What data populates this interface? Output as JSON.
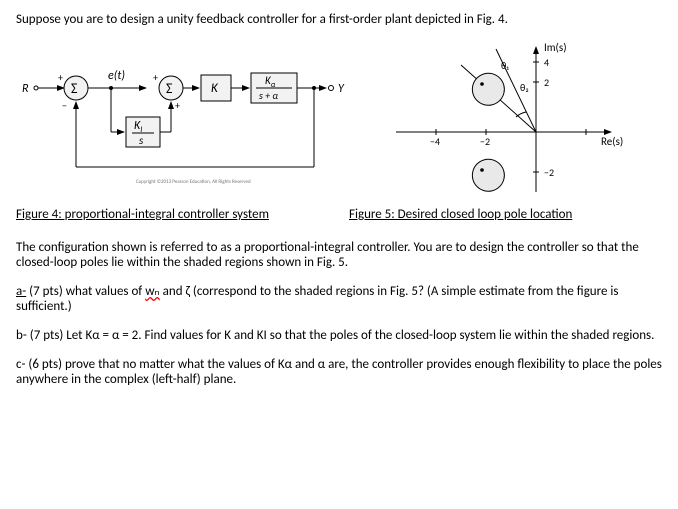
{
  "intro": "Suppose you are to design a unity feedback controller for a first-order plant depicted in Fig. 4.",
  "diagram": {
    "R": "R",
    "sum1": "Σ",
    "e_t": "e(t)",
    "sum2": "Σ",
    "K": "K",
    "plant_num": "K",
    "plant_num_sub": "α",
    "plant_den": "s + α",
    "Y": "Y",
    "ki_num": "K",
    "ki_num_sub": "I",
    "ki_den": "s",
    "plus1": "+",
    "minus1": "−",
    "plus2a": "+",
    "plus2b": "+",
    "copyright": "Copyright ©2013 Pearson Education, All Rights Reserved"
  },
  "splane": {
    "im": "Im(s)",
    "re": "Re(s)",
    "t4": "4",
    "t2": "2",
    "tm2": "−2",
    "tm4": "−4",
    "tn2": "−2",
    "theta1": "θ₁",
    "theta2": "θ₂"
  },
  "fig4_caption": "Figure 4: proportional-integral controller system",
  "fig5_caption": "Figure 5: Desired closed loop pole location",
  "body_para": "The configuration shown is referred to as a proportional-integral controller. You are to design the controller so that the closed-loop poles lie within the shaded regions shown in Fig. 5.",
  "qa_prefix": "a-",
  "qa_pts": " (7 pts) what values of ",
  "qa_wn": "wₙ",
  "qa_mid": " and ζ (correspond to the shaded regions in Fig. 5? (A simple estimate from the figure is sufficient.)",
  "qb": "b- (7 pts) Let Kα = α = 2. Find values for K and KI so that the poles of the closed-loop system lie within the shaded regions.",
  "qc": "c- (6 pts) prove that no matter what the values of Kα and α are, the controller provides enough flexibility to place the poles anywhere in the complex (left-half) plane."
}
